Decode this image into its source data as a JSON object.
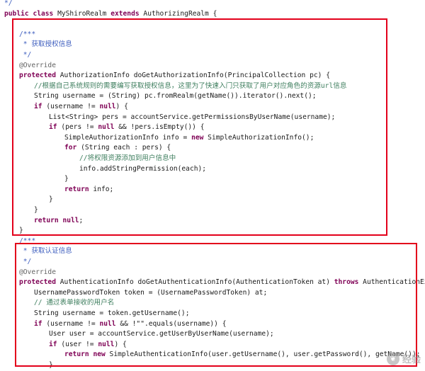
{
  "lines": [
    {
      "indent": 0,
      "tokens": [
        {
          "t": "*/",
          "c": "doc"
        }
      ]
    },
    {
      "indent": 0,
      "tokens": [
        {
          "t": "public",
          "c": "kw"
        },
        {
          "t": " "
        },
        {
          "t": "class",
          "c": "kw"
        },
        {
          "t": " MyShiroRealm "
        },
        {
          "t": "extends",
          "c": "kw"
        },
        {
          "t": " AuthorizingRealm {"
        }
      ]
    },
    {
      "indent": 0,
      "tokens": []
    },
    {
      "indent": 1,
      "tokens": [
        {
          "t": "/***",
          "c": "doc"
        }
      ]
    },
    {
      "indent": 1,
      "tokens": [
        {
          "t": " * 获取授权信息",
          "c": "doc"
        }
      ]
    },
    {
      "indent": 1,
      "tokens": [
        {
          "t": " */",
          "c": "doc"
        }
      ]
    },
    {
      "indent": 1,
      "tokens": [
        {
          "t": "@Override",
          "c": "an"
        }
      ]
    },
    {
      "indent": 1,
      "tokens": [
        {
          "t": "protected",
          "c": "kw"
        },
        {
          "t": " AuthorizationInfo doGetAuthorizationInfo(PrincipalCollection pc) {"
        }
      ]
    },
    {
      "indent": 2,
      "tokens": [
        {
          "t": "//根据自己系统规则的需要编写获取授权信息，这里为了快速入门只获取了用户对应角色的资源url信息",
          "c": "cm"
        }
      ]
    },
    {
      "indent": 2,
      "tokens": [
        {
          "t": "String username = (String) pc.fromRealm(getName()).iterator().next();"
        }
      ]
    },
    {
      "indent": 2,
      "tokens": [
        {
          "t": "if",
          "c": "kw"
        },
        {
          "t": " (username != "
        },
        {
          "t": "null",
          "c": "kw"
        },
        {
          "t": ") {"
        }
      ]
    },
    {
      "indent": 3,
      "tokens": [
        {
          "t": "List<String> pers = accountService.getPermissionsByUserName(username);"
        }
      ]
    },
    {
      "indent": 3,
      "tokens": [
        {
          "t": "if",
          "c": "kw"
        },
        {
          "t": " (pers != "
        },
        {
          "t": "null",
          "c": "kw"
        },
        {
          "t": " && !pers.isEmpty()) {"
        }
      ]
    },
    {
      "indent": 4,
      "tokens": [
        {
          "t": "SimpleAuthorizationInfo info = "
        },
        {
          "t": "new",
          "c": "kw"
        },
        {
          "t": " SimpleAuthorizationInfo();"
        }
      ]
    },
    {
      "indent": 4,
      "tokens": [
        {
          "t": "for",
          "c": "kw"
        },
        {
          "t": " (String each : pers) {"
        }
      ]
    },
    {
      "indent": 5,
      "tokens": [
        {
          "t": "//将权限资源添加到用户信息中",
          "c": "cm"
        }
      ]
    },
    {
      "indent": 5,
      "tokens": [
        {
          "t": "info.addStringPermission(each);"
        }
      ]
    },
    {
      "indent": 4,
      "tokens": [
        {
          "t": "}"
        }
      ]
    },
    {
      "indent": 4,
      "tokens": [
        {
          "t": "return",
          "c": "kw"
        },
        {
          "t": " info;"
        }
      ]
    },
    {
      "indent": 3,
      "tokens": [
        {
          "t": "}"
        }
      ]
    },
    {
      "indent": 2,
      "tokens": [
        {
          "t": "}"
        }
      ]
    },
    {
      "indent": 2,
      "tokens": [
        {
          "t": "return",
          "c": "kw"
        },
        {
          "t": " "
        },
        {
          "t": "null",
          "c": "kw"
        },
        {
          "t": ";"
        }
      ]
    },
    {
      "indent": 1,
      "tokens": [
        {
          "t": "}"
        }
      ]
    },
    {
      "indent": 1,
      "tokens": [
        {
          "t": "/***",
          "c": "doc"
        }
      ]
    },
    {
      "indent": 1,
      "tokens": [
        {
          "t": " * 获取认证信息",
          "c": "doc"
        }
      ]
    },
    {
      "indent": 1,
      "tokens": [
        {
          "t": " */",
          "c": "doc"
        }
      ]
    },
    {
      "indent": 1,
      "tokens": [
        {
          "t": "@Override",
          "c": "an"
        }
      ]
    },
    {
      "indent": 1,
      "tokens": [
        {
          "t": "protected",
          "c": "kw"
        },
        {
          "t": " AuthenticationInfo doGetAuthenticationInfo(AuthenticationToken at) "
        },
        {
          "t": "throws",
          "c": "kw"
        },
        {
          "t": " AuthenticationExce"
        }
      ]
    },
    {
      "indent": 2,
      "tokens": [
        {
          "t": "UsernamePasswordToken token = (UsernamePasswordToken) at;"
        }
      ]
    },
    {
      "indent": 2,
      "tokens": [
        {
          "t": "// 通过表单接收的用户名",
          "c": "cm"
        }
      ]
    },
    {
      "indent": 2,
      "tokens": [
        {
          "t": "String username = token.getUsername();"
        }
      ]
    },
    {
      "indent": 2,
      "tokens": [
        {
          "t": "if",
          "c": "kw"
        },
        {
          "t": " (username != "
        },
        {
          "t": "null",
          "c": "kw"
        },
        {
          "t": " && !\"\".equals(username)) {"
        }
      ]
    },
    {
      "indent": 3,
      "tokens": [
        {
          "t": "User user = accountService.getUserByUserName(username);"
        }
      ]
    },
    {
      "indent": 3,
      "tokens": [
        {
          "t": "if",
          "c": "kw"
        },
        {
          "t": " (user != "
        },
        {
          "t": "null",
          "c": "kw"
        },
        {
          "t": ") {"
        }
      ]
    },
    {
      "indent": 4,
      "tokens": [
        {
          "t": "return",
          "c": "kw"
        },
        {
          "t": " "
        },
        {
          "t": "new",
          "c": "kw"
        },
        {
          "t": " SimpleAuthenticationInfo(user.getUsername(), user.getPassword(), getName());"
        }
      ]
    },
    {
      "indent": 3,
      "tokens": [
        {
          "t": "}"
        }
      ]
    }
  ],
  "colors": {
    "keyword": "#7f0055",
    "comment": "#3f7f5f",
    "javadoc": "#3f5fbf",
    "annotation": "#646464",
    "highlight_box": "#e3001b"
  },
  "watermark": {
    "icon": "paw-icon",
    "text": "经验"
  }
}
